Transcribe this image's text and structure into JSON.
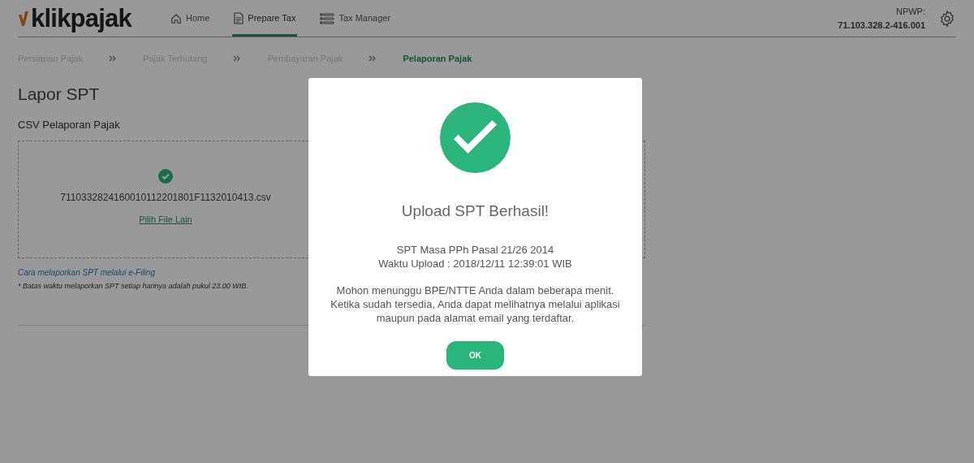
{
  "logo": "klikpajak",
  "nav": [
    {
      "label": "Home",
      "kind": "home",
      "selected": false
    },
    {
      "label": "Prepare Tax",
      "kind": "document",
      "selected": true
    },
    {
      "label": "Tax Manager",
      "kind": "list",
      "selected": false
    }
  ],
  "npwp": {
    "label": "NPWP:",
    "value": "71.103.328.2-416.001"
  },
  "steps": [
    {
      "label": "Persiapan Pajak",
      "selected": false
    },
    {
      "label": "Pajak Terhutang",
      "selected": false
    },
    {
      "label": "Pembayaran Pajak",
      "selected": false
    },
    {
      "label": "Pelaporan Pajak",
      "selected": true
    }
  ],
  "page_title": "Lapor SPT",
  "section_label": "CSV Pelaporan Pajak",
  "upload": {
    "file_name": "7110332824160010112201801F1132010413.csv",
    "change_link": "Pilih File Lain"
  },
  "help_link": "Cara melaporkan SPT melalui e-Filing",
  "note": "* Batas waktu melaporkan SPT setiap harinya adalah pukul 23.00 WIB.",
  "dialog": {
    "title": "Upload SPT Berhasil!",
    "details": [
      "SPT Masa PPh Pasal 21/26 2014",
      "Waktu Upload : 2018/12/11 12:39:01 WIB"
    ],
    "message": [
      "Mohon menunggu BPE/NTTE Anda dalam beberapa menit.",
      "Ketika sudah tersedia, Anda dapat melihatnya melalui aplikasi",
      "maupun pada alamat email yang terdaftar."
    ],
    "button": "OK"
  }
}
